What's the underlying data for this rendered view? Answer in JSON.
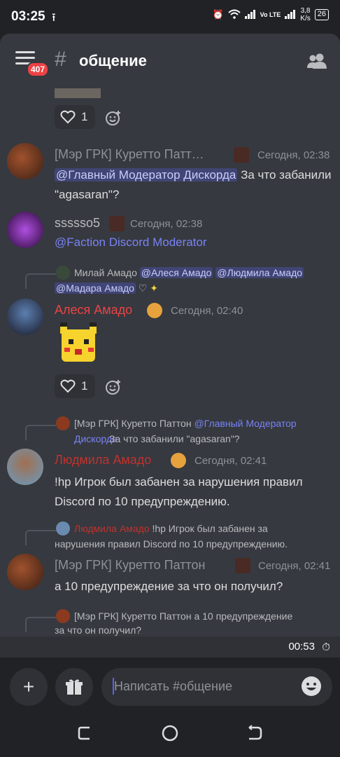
{
  "status_bar": {
    "time": "03:25",
    "network_speed": "3,8",
    "network_unit": "K/s",
    "battery": "26",
    "volte": "Vo LTE"
  },
  "header": {
    "unread_badge": "407",
    "channel_hash": "#",
    "channel_name": "общение"
  },
  "messages": [
    {
      "id": "m0",
      "reaction_count": "1"
    },
    {
      "id": "m1",
      "author": "[Мэр ГРК] Куретто Патт…",
      "author_color": "#8e9297",
      "time": "Сегодня, 02:38",
      "mention": "@Главный Модератор Дискорда",
      "text": "За что забанили \"agasaran\"?"
    },
    {
      "id": "m2",
      "author": "ssssso5",
      "author_color": "#b9bbbe",
      "time": "Сегодня, 02:38",
      "mention": "@Faction Discord Moderator"
    },
    {
      "id": "m3",
      "reply_author": "Милай Амадо",
      "reply_mentions": [
        "@Алеся Амадо",
        "@Людмила Амадо",
        "@Мадара Амадо"
      ],
      "author": "Алеся Амадо",
      "author_color": "#ed4245",
      "time": "Сегодня, 02:40",
      "reaction_count": "1"
    },
    {
      "id": "m4",
      "reply_author": "[Мэр ГРК] Куретто Паттон",
      "reply_mention": "@Главный Модератор Дискорда",
      "reply_text": "За что забанили \"agasaran\"?",
      "author": "Людмила Амадо",
      "author_color": "#c0322e",
      "time": "Сегодня, 02:41",
      "text_line1": "!hp Игрок был забанен за нарушения правил",
      "text_line2": "Discord по 10 предупреждению."
    },
    {
      "id": "m5",
      "reply_author": "Людмила Амадо",
      "reply_text_line1": "!hp Игрок был забанен за",
      "reply_text_line2": "нарушения правил Discord по 10 предупреждению.",
      "author": "[Мэр ГРК] Куретто Паттон",
      "author_color": "#8e9297",
      "time": "Сегодня, 02:41",
      "text": "а 10 предупреждение за что он получил?"
    },
    {
      "id": "m6",
      "reply_author": "[Мэр ГРК] Куретто Паттон",
      "reply_text_line1": "а 10 предупреждение",
      "reply_text_line2": "за что он получил?"
    }
  ],
  "slowmode_timer": "00:53",
  "composer": {
    "placeholder": "Написать #общение"
  },
  "colors": {
    "background": "#36393f",
    "accent": "#5865f2",
    "mention": "#7983f5"
  }
}
